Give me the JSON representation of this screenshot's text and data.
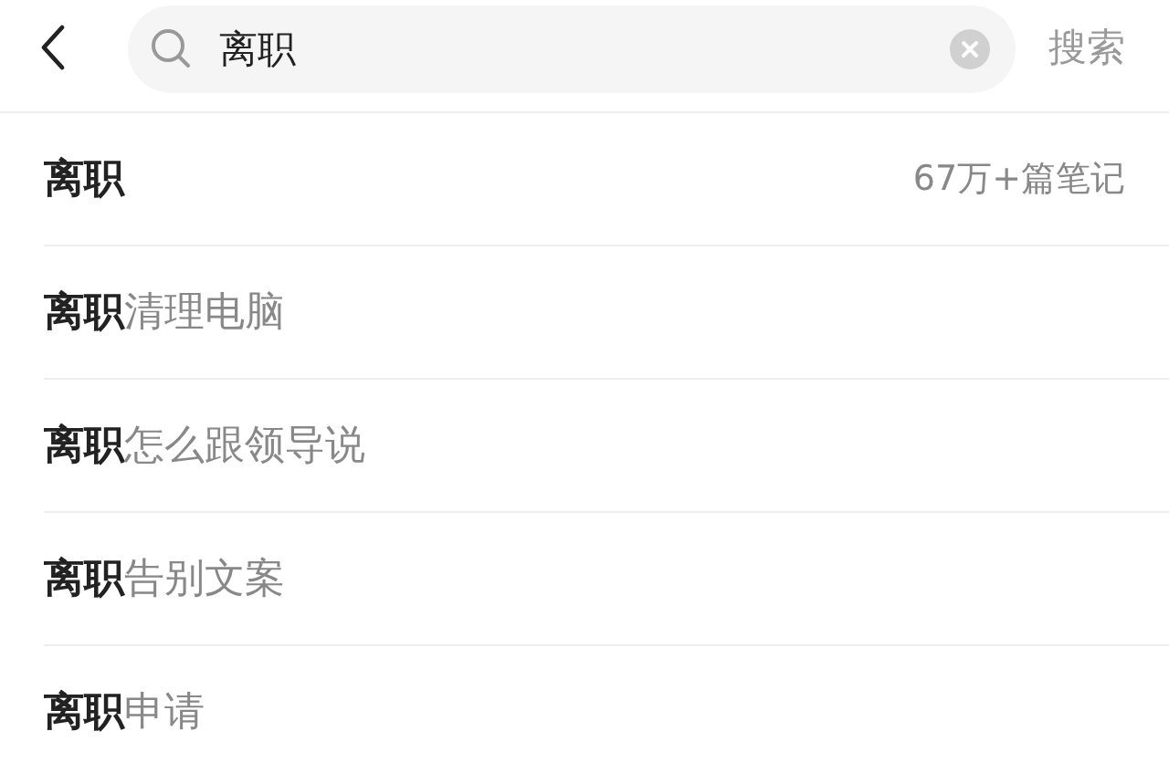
{
  "search_bar": {
    "value": "离职",
    "button": "搜索"
  },
  "suggestions": [
    {
      "text": "**离职**",
      "count": "67万+篇笔记"
    },
    {
      "text": "**离职**清理电脑"
    },
    {
      "text": "**离职**怎么跟领导说"
    },
    {
      "text": "**离职**告别文案"
    },
    {
      "text": "**离职**申请"
    }
  ]
}
